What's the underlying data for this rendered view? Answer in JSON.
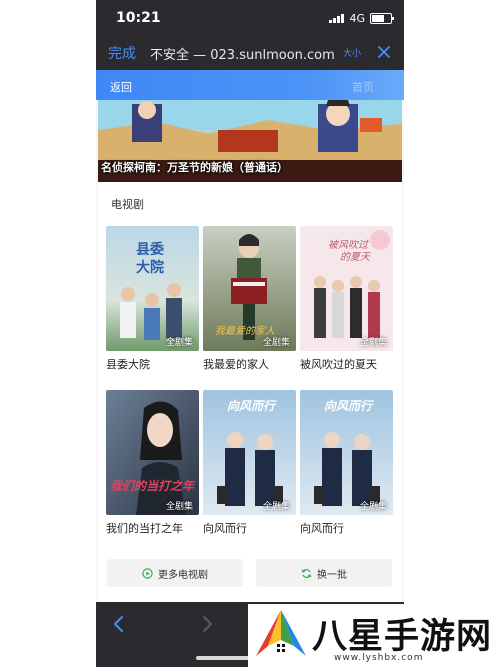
{
  "status_bar": {
    "time": "10:21",
    "network": "4G"
  },
  "browser": {
    "done_label": "完成",
    "url_text": "不安全 — 023.sunlmoon.com",
    "text_size_label": "大小"
  },
  "site_header": {
    "back_label": "返回",
    "home_label": "首页"
  },
  "banner": {
    "caption": "名侦探柯南：万圣节的新娘（普通话）"
  },
  "section": {
    "title": "电视剧",
    "badge": "全剧集",
    "items": [
      {
        "title": "县委大院"
      },
      {
        "title": "我最爱的家人"
      },
      {
        "title": "被风吹过的夏天"
      },
      {
        "title": "我们的当打之年"
      },
      {
        "title": "向风而行"
      },
      {
        "title": "向风而行"
      }
    ],
    "more_label": "更多电视剧",
    "refresh_label": "换一批"
  },
  "watermark": {
    "title": "八星手游网",
    "url": "www.lyshbx.com"
  },
  "colors": {
    "accent": "#4a8cf7",
    "header": "#3f87f5",
    "dark_bar": "#2b2b2f",
    "green": "#2bb24c"
  }
}
